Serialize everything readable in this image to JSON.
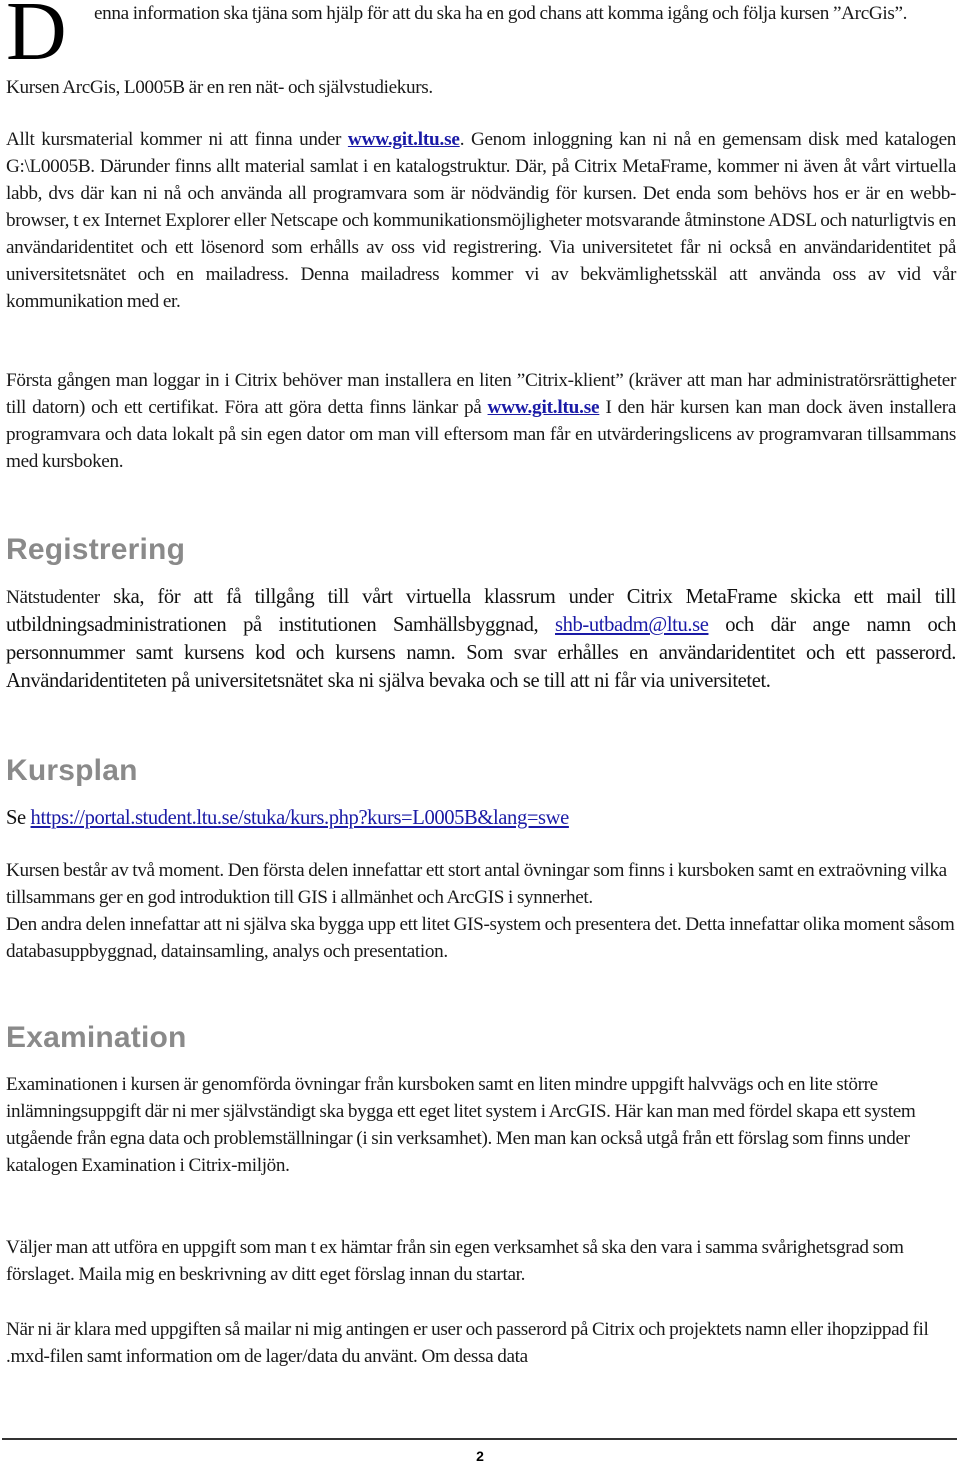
{
  "intro": {
    "dropcap": "D",
    "text": "enna information ska tjäna som hjälp för att du ska ha en god chans att komma igång och följa kursen ”ArcGis”."
  },
  "paragraphs": {
    "kursen": "Kursen ArcGis, L0005B är en ren nät- och självstudiekurs.",
    "allt": {
      "before_link": "Allt kursmaterial kommer ni att finna under ",
      "link": "www.git.ltu.se",
      "after_link": ". Genom inloggning kan ni nå en gemensam disk med katalogen G:\\L0005B. Därunder finns allt material samlat i en katalogstruktur. Där, på Citrix MetaFrame,  kommer ni även åt vårt virtuella labb, dvs där kan ni nå och använda all programvara som är nödvändig för kursen. Det enda som behövs hos er är en webb-browser, t ex Internet Explorer eller Netscape och kommunikationsmöjligheter motsvarande åtminstone ADSL och naturligtvis en användaridentitet och ett lösenord som erhålls av oss vid registrering. Via universitetet får ni också en användaridentitet på universitetsnätet och en mailadress. Denna mailadress kommer vi av bekvämlighetsskäl att använda oss av vid vår kommunikation med er."
    },
    "forsta": {
      "before_link": "Första gången man loggar in i Citrix behöver man installera en liten ”Citrix-klient” (kräver att man har administratörsrättigheter till datorn) och ett certifikat. Föra att göra detta finns länkar på ",
      "link": "www.git.ltu.se",
      "after_link": " I den här kursen kan man dock även installera programvara och data lokalt på sin egen dator om man vill eftersom man får en utvärderingslicens av programvaran tillsammans med kursboken."
    }
  },
  "sections": {
    "registrering": {
      "heading": "Registrering",
      "lead": "Nätstudenter",
      "before_link": " ska, för att få tillgång till vårt virtuella klassrum under Citrix MetaFrame skicka ett mail till utbildningsadministrationen på  institutionen Samhällsbyggnad, ",
      "email": "shb-utbadm@ltu.se",
      "after_link": "  och där ange namn och personnummer samt kursens kod och kursens namn. Som svar erhålles en användaridentitet och ett passerord. Användaridentiteten på universitetsnätet ska ni själva bevaka och se till att ni får via universitetet."
    },
    "kursplan": {
      "heading": "Kursplan",
      "prefix": "Se ",
      "link": "https://portal.student.ltu.se/stuka/kurs.php?kurs=L0005B&lang=swe",
      "body_1": "Kursen består av två moment. Den första delen innefattar ett stort antal övningar som finns i kursboken samt en extraövning vilka tillsammans ger en god introduktion till GIS i allmänhet och ArcGIS i synnerhet.",
      "body_2": "Den andra delen innefattar att ni själva ska bygga upp ett litet GIS-system och presentera det. Detta innefattar olika moment såsom databasuppbyggnad, datainsamling, analys och presentation."
    },
    "examination": {
      "heading": "Examination",
      "body_1": "Examinationen i kursen är genomförda övningar från kursboken samt en liten mindre uppgift halvvägs och en lite större inlämningsuppgift där ni mer självständigt ska bygga ett eget litet system i ArcGIS. Här kan man med fördel skapa ett system utgående från egna data och problemställningar (i sin verksamhet). Men man kan också utgå från ett förslag som finns under katalogen Examination i Citrix-miljön.",
      "body_2": "Väljer man att utföra en uppgift som man t ex hämtar från sin egen verksamhet så ska den vara i samma svårighetsgrad som förslaget. Maila mig en beskrivning av ditt eget förslag innan du startar.",
      "body_3": "När ni är klara med uppgiften så mailar ni mig antingen er user och passerord på Citrix och projektets namn eller ihopzippad fil .mxd-filen samt information om de lager/data du använt. Om dessa data"
    }
  },
  "footer": {
    "page_number": "2"
  },
  "colors": {
    "link": "#1a1aa6",
    "heading": "#8a8a8a",
    "text": "#1a1a1a",
    "rule": "#333333"
  }
}
